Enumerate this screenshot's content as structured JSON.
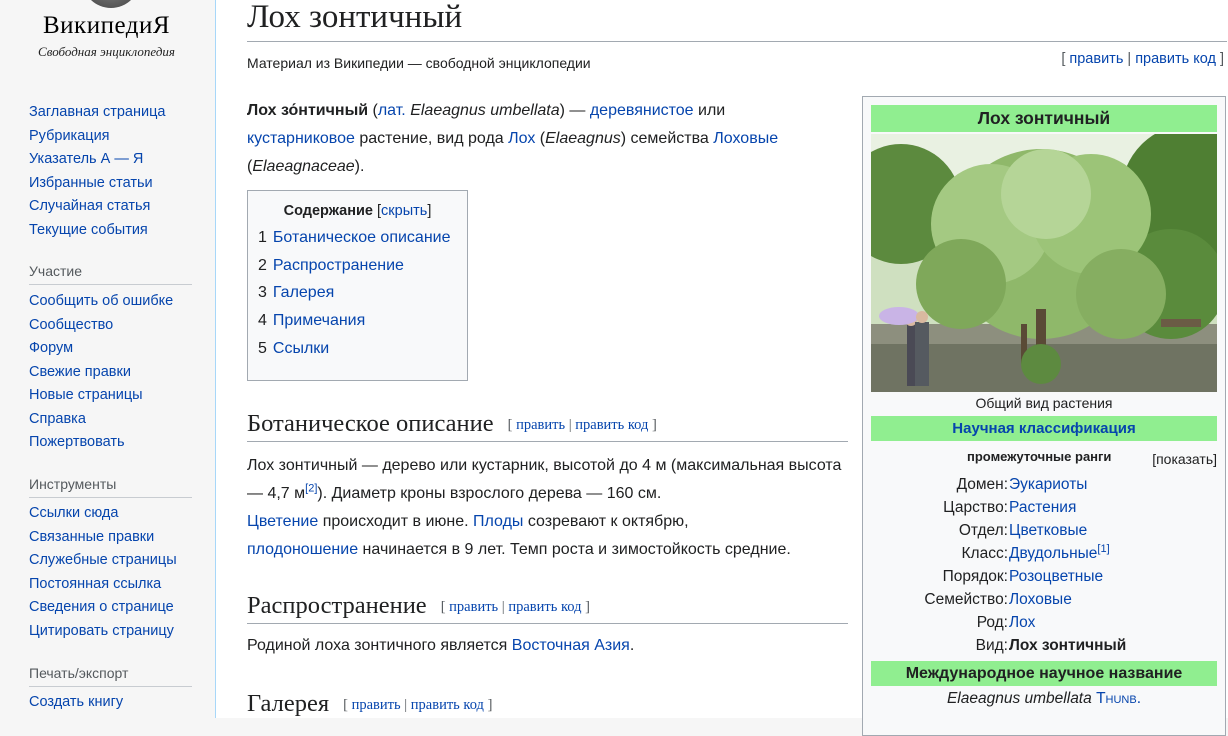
{
  "sidebar": {
    "logo_title": "ВикипедиЯ",
    "logo_tagline": "Свободная энциклопедия",
    "nav_main": [
      "Заглавная страница",
      "Рубрикация",
      "Указатель А — Я",
      "Избранные статьи",
      "Случайная статья",
      "Текущие события"
    ],
    "participation_heading": "Участие",
    "nav_participation": [
      "Сообщить об ошибке",
      "Сообщество",
      "Форум",
      "Свежие правки",
      "Новые страницы",
      "Справка",
      "Пожертвовать"
    ],
    "tools_heading": "Инструменты",
    "nav_tools": [
      "Ссылки сюда",
      "Связанные правки",
      "Служебные страницы",
      "Постоянная ссылка",
      "Сведения о странице",
      "Цитировать страницу"
    ],
    "print_heading": "Печать/экспорт",
    "nav_print": [
      "Создать книгу"
    ]
  },
  "article": {
    "title": "Лох зонтичный",
    "site_sub": "Материал из Википедии — свободной энциклопедии",
    "edit": "править",
    "edit_code": "править код",
    "intro": {
      "bold_name": "Лох зо́нтичный",
      "lat_link": "лат.",
      "latin_name": "Elaeagnus umbellata",
      "dash": ") — ",
      "woody_link": "деревянистое",
      "or": " или ",
      "shrub_link": "кустарниковое",
      "mid": " растение, вид рода ",
      "genus_link": "Лох",
      "genus_latin": "Elaeagnus",
      "family_text": ") семейства ",
      "family_link": "Лоховые",
      "family_latin": "Elaeagnaceae",
      "end": ")."
    },
    "toc": {
      "title": "Содержание",
      "hide": "скрыть",
      "items": [
        {
          "num": "1",
          "label": "Ботаническое описание"
        },
        {
          "num": "2",
          "label": "Распространение"
        },
        {
          "num": "3",
          "label": "Галерея"
        },
        {
          "num": "4",
          "label": "Примечания"
        },
        {
          "num": "5",
          "label": "Ссылки"
        }
      ]
    },
    "sections": {
      "botanical": {
        "heading": "Ботаническое описание",
        "p1": "Лох зонтичный — дерево или кустарник, высотой до 4 м (максимальная высота — 4,7 м",
        "ref": "[2]",
        "p2": "). Диаметр кроны взрослого дерева — 160 см.",
        "flowering_link": "Цветение",
        "p3": " происходит в июне. ",
        "fruit_link": "Плоды",
        "p4": " созревают к октябрю,",
        "fruiting_link": "плодоношение",
        "p5": " начинается в 9 лет. Темп роста и зимостойкость средние."
      },
      "distribution": {
        "heading": "Распространение",
        "text": "Родиной лоха зонтичного является ",
        "region_link": "Восточная Азия",
        "end": "."
      },
      "gallery": {
        "heading": "Галерея"
      }
    }
  },
  "infobox": {
    "title": "Лох зонтичный",
    "image_caption": "Общий вид растения",
    "classification_header": "Научная классификация",
    "ranks_label": "промежуточные ранги",
    "ranks_show": "[показать]",
    "rows": [
      {
        "key": "Домен:",
        "value": "Эукариоты",
        "link": true
      },
      {
        "key": "Царство:",
        "value": "Растения",
        "link": true
      },
      {
        "key": "Отдел:",
        "value": "Цветковые",
        "link": true
      },
      {
        "key": "Класс:",
        "value": "Двудольные",
        "link": true,
        "ref": "[1]"
      },
      {
        "key": "Порядок:",
        "value": "Розоцветные",
        "link": true
      },
      {
        "key": "Семейство:",
        "value": "Лоховые",
        "link": true
      },
      {
        "key": "Род:",
        "value": "Лох",
        "link": true
      },
      {
        "key": "Вид:",
        "value": "Лох зонтичный",
        "link": false
      }
    ],
    "intl_header": "Международное научное название",
    "intl_name": "Elaeagnus umbellata",
    "intl_author": "Thunb."
  },
  "colors": {
    "link": "#0645ad",
    "infobox_header": "#90ee90",
    "sidebar_bg": "#f6f6f6",
    "border": "#a2a9b1"
  }
}
